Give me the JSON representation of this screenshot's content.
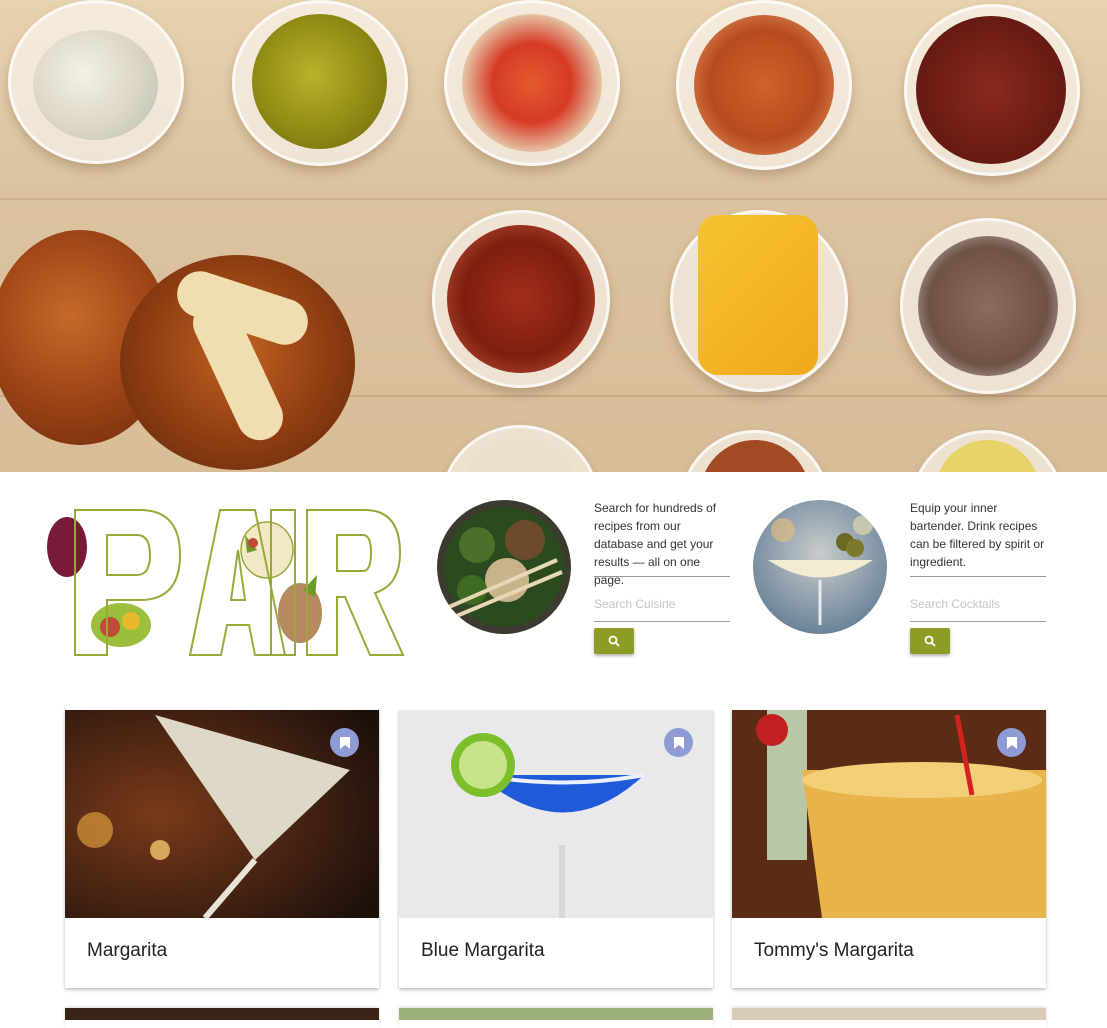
{
  "hero": {
    "image": "food-spread-photo"
  },
  "logo": {
    "text": "PAIR"
  },
  "cuisine": {
    "description": "Search for hundreds of recipes from our database and get your results — all on one page.",
    "placeholder": "Search Cuisine",
    "button_icon": "search-icon"
  },
  "cocktails": {
    "description": "Equip your inner bartender. Drink recipes can be filtered by spirit or ingredient.",
    "placeholder": "Search Cocktails",
    "button_icon": "search-icon"
  },
  "cards": [
    {
      "title": "Margarita",
      "icon": "bookmark-icon"
    },
    {
      "title": "Blue Margarita",
      "icon": "bookmark-icon"
    },
    {
      "title": "Tommy's Margarita",
      "icon": "bookmark-icon"
    }
  ],
  "colors": {
    "accent": "#8e9c25",
    "bookmark": "#8f9bd4",
    "logo_outline": "#9aa83a"
  }
}
